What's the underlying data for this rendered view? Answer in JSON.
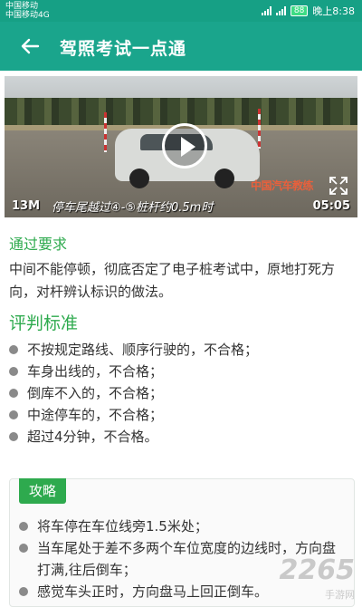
{
  "status": {
    "carrier_1": "中国移动",
    "carrier_2": "中国移动4G",
    "battery": "88",
    "time": "晚上8:38"
  },
  "appbar": {
    "title": "驾照考试一点通"
  },
  "video": {
    "size_label": "13M",
    "subtitle": "停车尾越过④-⑤桩杆约0.5m时",
    "duration": "05:05",
    "watermark": "中国汽车教练"
  },
  "section1": {
    "title": "通过要求",
    "text": "中间不能停顿，彻底否定了电子桩考试中，原地打死方向，对杆辨认标识的做法。"
  },
  "section2": {
    "title": "评判标准",
    "items": [
      "不按规定路线、顺序行驶的，不合格；",
      "车身出线的，不合格；",
      "倒库不入的，不合格；",
      "中途停车的，不合格；",
      "超过4分钟，不合格。"
    ]
  },
  "tips": {
    "tab_label": "攻略",
    "items": [
      "将车停在车位线旁1.5米处；",
      "当车尾处于差不多两个车位宽度的边线时，方向盘打满,往后倒车；",
      "感觉车头正时，方向盘马上回正倒车。"
    ]
  },
  "site_watermark": {
    "main": "2265",
    "sub": "手游网"
  },
  "colors": {
    "primary": "#1aa58c",
    "accent_green": "#2eaa4e",
    "text": "#333333"
  }
}
